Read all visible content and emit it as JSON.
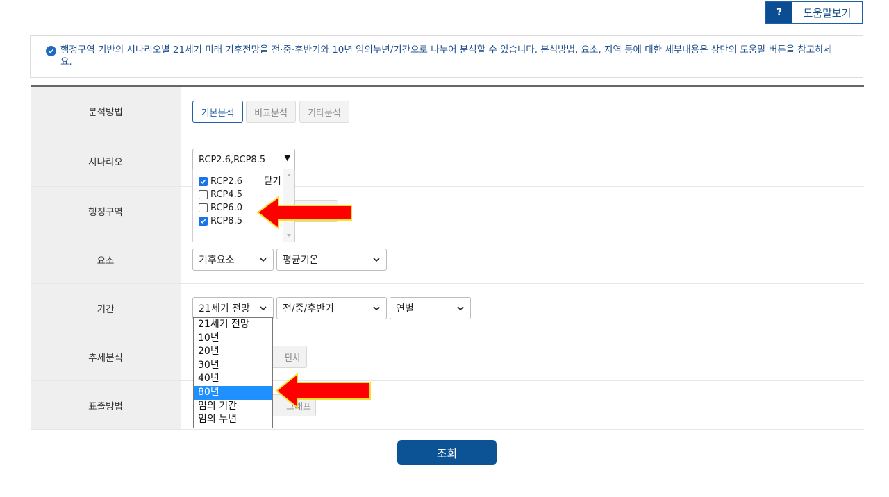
{
  "help": {
    "icon_text": "?",
    "label": "도움말보기"
  },
  "notice": {
    "icon": "check-circle-icon",
    "text": "행정구역 기반의 시나리오별 21세기 미래 기후전망을 전·중·후반기와 10년 임의누년/기간으로 나누어 분석할 수 있습니다. 분석방법, 요소, 지역 등에 대한 세부내용은 상단의 도움말 버튼을 참고하세요."
  },
  "form": {
    "method": {
      "label": "분석방법",
      "tabs": [
        "기본분석",
        "비교분석",
        "기타분석"
      ],
      "active": "기본분석"
    },
    "scenario": {
      "label": "시나리오",
      "value": "RCP2.6,RCP8.5",
      "close_label": "닫기",
      "options": [
        {
          "label": "RCP2.6",
          "checked": true
        },
        {
          "label": "RCP4.5",
          "checked": false
        },
        {
          "label": "RCP6.0",
          "checked": false
        },
        {
          "label": "RCP8.5",
          "checked": true
        }
      ]
    },
    "region": {
      "label": "행정구역"
    },
    "element": {
      "label": "요소",
      "category": "기후요소",
      "item": "평균기온"
    },
    "period": {
      "label": "기간",
      "type": "21세기 전망",
      "range": "전/중/후반기",
      "unit": "연별",
      "options": [
        "21세기 전망",
        "10년",
        "20년",
        "30년",
        "40년",
        "80년",
        "임의 기간",
        "임의 누년"
      ],
      "highlighted": "80년"
    },
    "trend": {
      "label": "추세분석",
      "partial_option": "편차"
    },
    "output": {
      "label": "표출방법",
      "partial_option": "그래프"
    }
  },
  "search_button": "조회",
  "colors": {
    "primary": "#0b5394",
    "accent_blue": "#1e90ff",
    "annotation_arrow": "#ff0000",
    "arrow_outline": "#f5e030"
  }
}
